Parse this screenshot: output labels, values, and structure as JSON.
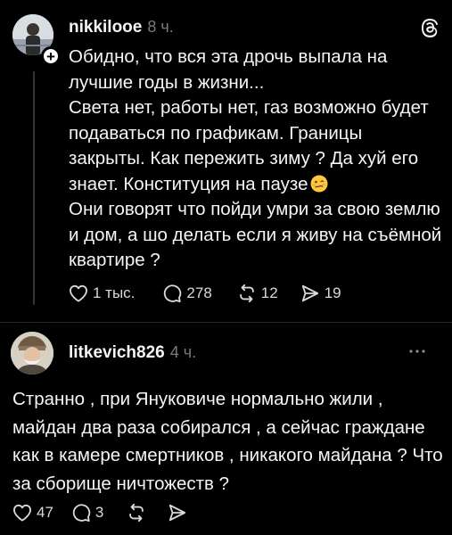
{
  "post1": {
    "username": "nikkilooe",
    "time": "8 ч.",
    "follow_symbol": "+",
    "lines": [
      "Обидно, что вся эта дрочь выпала на лучшие годы в жизни...",
      "Света нет, работы нет, газ возможно будет подаваться по графикам. Границы закрыты. Как пережить зиму ? Да хуй его знает. Конституция на паузе",
      "Они говорят что пойди умри за свою землю и дом, а шо делать если я живу на съёмной квартире ?"
    ],
    "emoji": "woozy-face",
    "likes": "1 тыс.",
    "replies": "278",
    "reposts": "12",
    "shares": "19"
  },
  "post2": {
    "username": "litkevich826",
    "time": "4 ч.",
    "lines": [
      "Странно , при Януковиче нормально жили , майдан два раза собирался , а сейчас граждане как в камере смертников , никакого майдана ? Что за сборище ничтожеств ?"
    ],
    "likes": "47",
    "replies": "3"
  },
  "icons": {
    "app_logo": "threads-logo-icon",
    "more": "more-dots-icon",
    "like": "heart-icon",
    "reply": "comment-icon",
    "repost": "repost-icon",
    "share": "send-icon"
  },
  "colors": {
    "background": "#000000",
    "text": "#f3f5f7",
    "muted": "#7a7a7a",
    "thread_line": "#333638"
  }
}
